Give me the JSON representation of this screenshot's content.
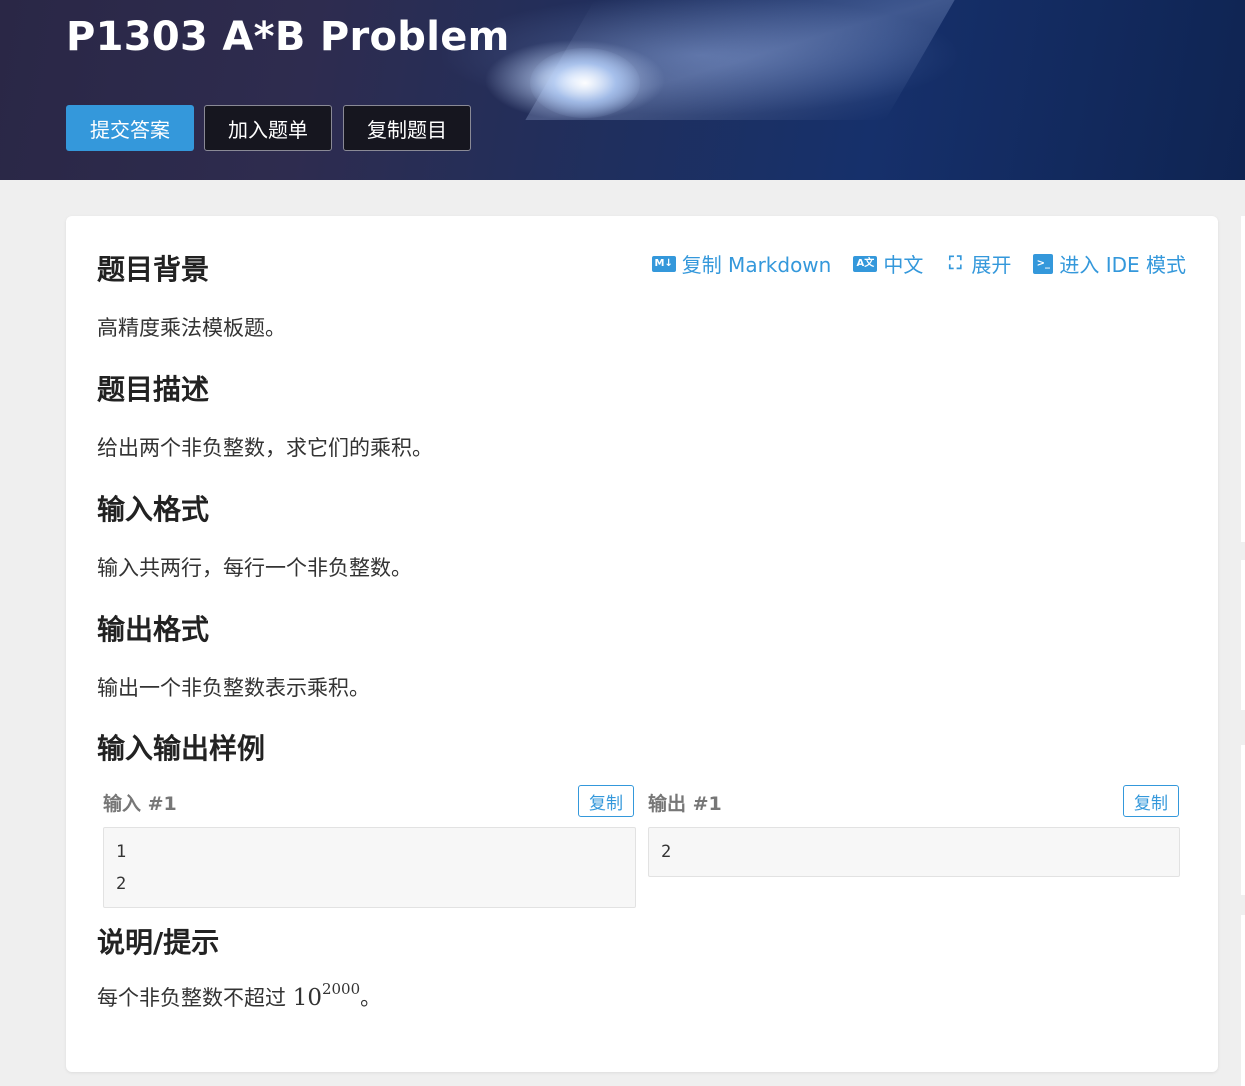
{
  "header": {
    "title": "P1303 A*B Problem",
    "buttons": {
      "submit": "提交答案",
      "add_list": "加入题单",
      "copy_problem": "复制题目"
    }
  },
  "toolbar": {
    "copy_markdown": "复制 Markdown",
    "language": "中文",
    "expand": "展开",
    "ide_mode": "进入 IDE 模式",
    "icons": [
      "markdown-icon",
      "translate-icon",
      "expand-icon",
      "terminal-icon"
    ]
  },
  "sections": {
    "background": {
      "heading": "题目背景",
      "text": "高精度乘法模板题。"
    },
    "description": {
      "heading": "题目描述",
      "text": "给出两个非负整数，求它们的乘积。"
    },
    "input_format": {
      "heading": "输入格式",
      "text": "输入共两行，每行一个非负整数。"
    },
    "output_format": {
      "heading": "输出格式",
      "text": "输出一个非负整数表示乘积。"
    },
    "samples": {
      "heading": "输入输出样例",
      "input_label": "输入 #1",
      "output_label": "输出 #1",
      "copy_label": "复制",
      "input_lines": [
        "1",
        "2"
      ],
      "output_lines": [
        "2"
      ]
    },
    "hint": {
      "heading": "说明/提示",
      "text_prefix": "每个非负整数不超过 ",
      "math_base": "10",
      "math_exp": "2000",
      "text_suffix": "。"
    }
  },
  "colors": {
    "accent": "#3498db",
    "page_bg": "#efefef",
    "dark_button": "#16161f"
  }
}
